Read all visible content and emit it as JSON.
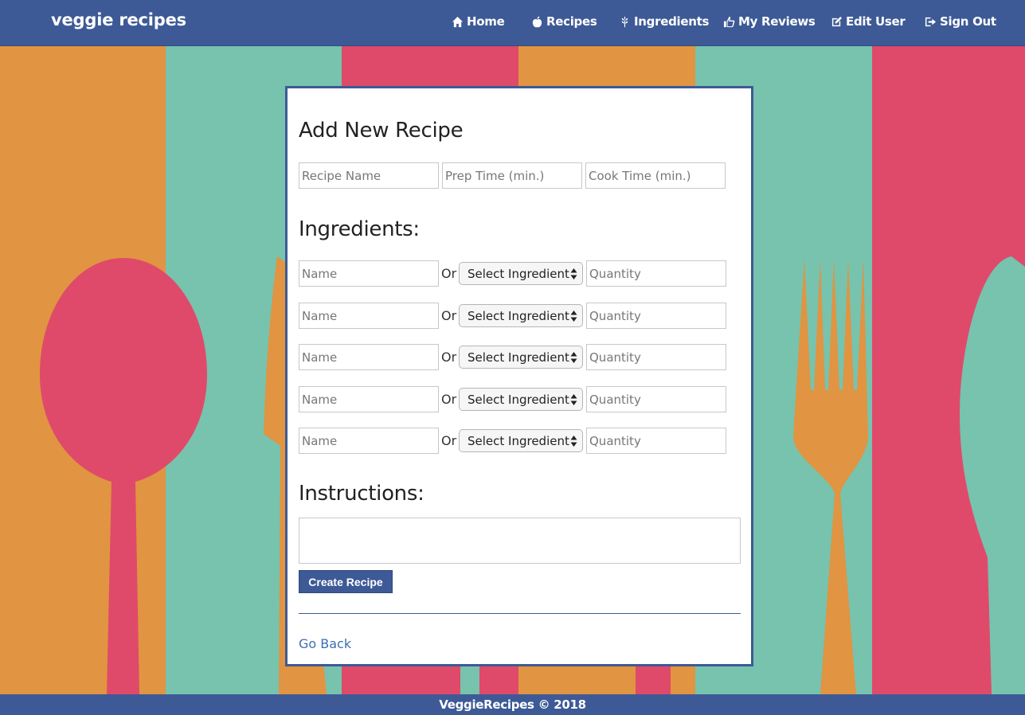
{
  "brand": "veggie recipes",
  "nav": {
    "home": {
      "label": "Home",
      "icon": "home-icon"
    },
    "recipes": {
      "label": "Recipes",
      "icon": "apple-icon"
    },
    "ingredients": {
      "label": "Ingredients",
      "icon": "grain-icon"
    },
    "reviews": {
      "label": "My Reviews",
      "icon": "thumbs-up-icon"
    },
    "edit_user": {
      "label": "Edit User",
      "icon": "edit-icon"
    },
    "sign_out": {
      "label": "Sign Out",
      "icon": "sign-out-icon"
    }
  },
  "form": {
    "title": "Add New Recipe",
    "recipe_name_placeholder": "Recipe Name",
    "prep_time_placeholder": "Prep Time (min.)",
    "cook_time_placeholder": "Cook Time (min.)",
    "ingredients_heading": "Ingredients:",
    "ingredient_rows": [
      {
        "name_placeholder": "Name",
        "or_label": "Or",
        "select_value": "Select Ingredient",
        "quantity_placeholder": "Quantity"
      },
      {
        "name_placeholder": "Name",
        "or_label": "Or",
        "select_value": "Select Ingredient",
        "quantity_placeholder": "Quantity"
      },
      {
        "name_placeholder": "Name",
        "or_label": "Or",
        "select_value": "Select Ingredient",
        "quantity_placeholder": "Quantity"
      },
      {
        "name_placeholder": "Name",
        "or_label": "Or",
        "select_value": "Select Ingredient",
        "quantity_placeholder": "Quantity"
      },
      {
        "name_placeholder": "Name",
        "or_label": "Or",
        "select_value": "Select Ingredient",
        "quantity_placeholder": "Quantity"
      }
    ],
    "instructions_heading": "Instructions:",
    "instructions_value": "",
    "submit_label": "Create Recipe",
    "go_back_label": "Go Back"
  },
  "footer": "VeggieRecipes © 2018",
  "colors": {
    "primary": "#3d5a96",
    "orange": "#e19441",
    "teal": "#77c3ae",
    "pink": "#df4a6a",
    "link": "#3d6fb0"
  }
}
